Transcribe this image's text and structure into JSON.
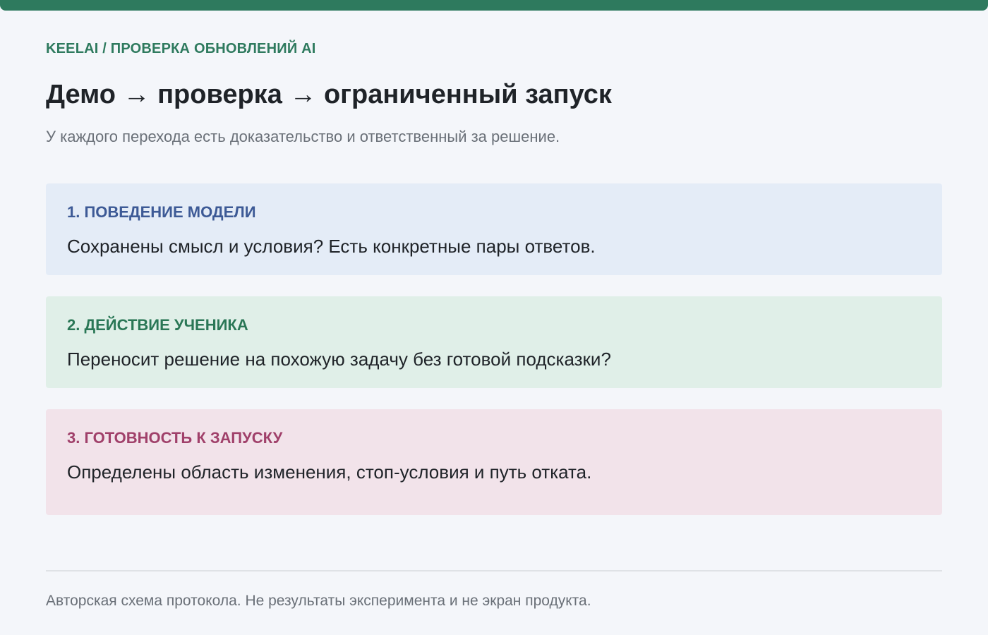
{
  "header": {
    "breadcrumb": "KEELAI / ПРОВЕРКА ОБНОВЛЕНИЙ AI",
    "title": "Демо → проверка → ограниченный запуск",
    "subtitle": "У каждого перехода есть доказательство и ответственный за решение."
  },
  "steps": [
    {
      "heading": "1. ПОВЕДЕНИЕ МОДЕЛИ",
      "body": "Сохранены смысл и условия? Есть конкретные пары ответов.",
      "accent": "#3d5a96",
      "background": "#e4ecf7"
    },
    {
      "heading": "2. ДЕЙСТВИЕ УЧЕНИКА",
      "body": "Переносит решение на похожую задачу без готовой подсказки?",
      "accent": "#2a7756",
      "background": "#e0efe8"
    },
    {
      "heading": "3. ГОТОВНОСТЬ К ЗАПУСКУ",
      "body": "Определены область изменения, стоп-условия и путь отката.",
      "accent": "#a0406a",
      "background": "#f2e3ea"
    }
  ],
  "footer": {
    "note": "Авторская схема протокола. Не результаты эксперимента и не экран продукта."
  },
  "colors": {
    "topbar": "#2e7a5e",
    "breadcrumb": "#2e7a5e"
  }
}
